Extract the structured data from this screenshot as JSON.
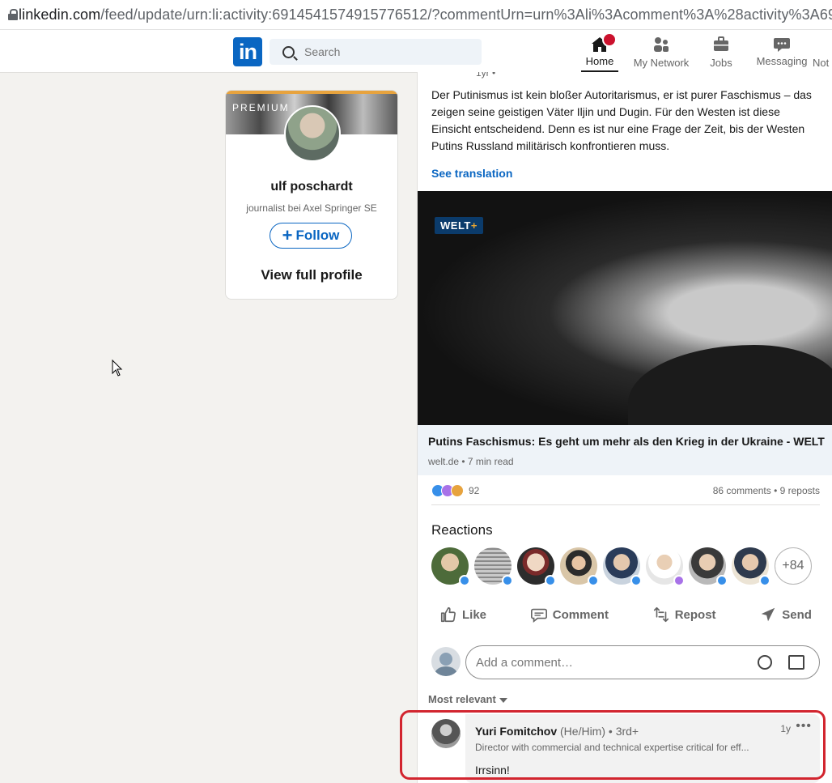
{
  "browser": {
    "url_host": "linkedin.com",
    "url_path": "/feed/update/urn:li:activity:6914541574915776512/?commentUrn=urn%3Ali%3Acomment%3A%28activity%3A69145"
  },
  "nav": {
    "logo": "in",
    "search_placeholder": "Search",
    "items": [
      {
        "label": "Home",
        "icon": "home-icon",
        "active": true
      },
      {
        "label": "My Network",
        "icon": "people-icon"
      },
      {
        "label": "Jobs",
        "icon": "briefcase-icon"
      },
      {
        "label": "Messaging",
        "icon": "chat-icon"
      },
      {
        "label": "Not",
        "icon": "bell-icon"
      }
    ]
  },
  "profile_card": {
    "premium_label": "PREMIUM",
    "name": "ulf poschardt",
    "headline": "journalist bei Axel Springer SE",
    "follow_label": "Follow",
    "view_profile_label": "View full profile"
  },
  "post": {
    "meta": "1yr •",
    "text": "Der Putinismus ist kein bloßer Autoritarismus, er ist purer Faschismus – das zeigen seine geistigen Väter Iljin und Dugin. Für den Westen ist diese Einsicht entscheidend. Denn es ist nur eine Frage der Zeit, bis der Westen Putins Russland militärisch konfrontieren muss.",
    "see_translation": "See translation",
    "image_badge": "WELT",
    "image_badge_plus": "+",
    "article_title": "Putins Faschismus: Es geht um mehr als den Krieg in der Ukraine - WELT",
    "article_source": "welt.de • 7 min read",
    "reaction_count": "92",
    "comments_reposts": "86 comments • 9 reposts",
    "reactions_title": "Reactions",
    "more_reactors": "+84",
    "actions": {
      "like": "Like",
      "comment": "Comment",
      "repost": "Repost",
      "send": "Send"
    },
    "comment_placeholder": "Add a comment…",
    "sort_label": "Most relevant"
  },
  "comment": {
    "author": "Yuri Fomitchov",
    "pronouns": "(He/Him)",
    "degree": "• 3rd+",
    "headline": "Director with commercial and technical expertise critical for eff...",
    "time": "1y",
    "text": "Irrsinn!"
  },
  "colors": {
    "brand": "#0a66c2",
    "highlight": "#d2252f",
    "badge": "#cb112d"
  }
}
